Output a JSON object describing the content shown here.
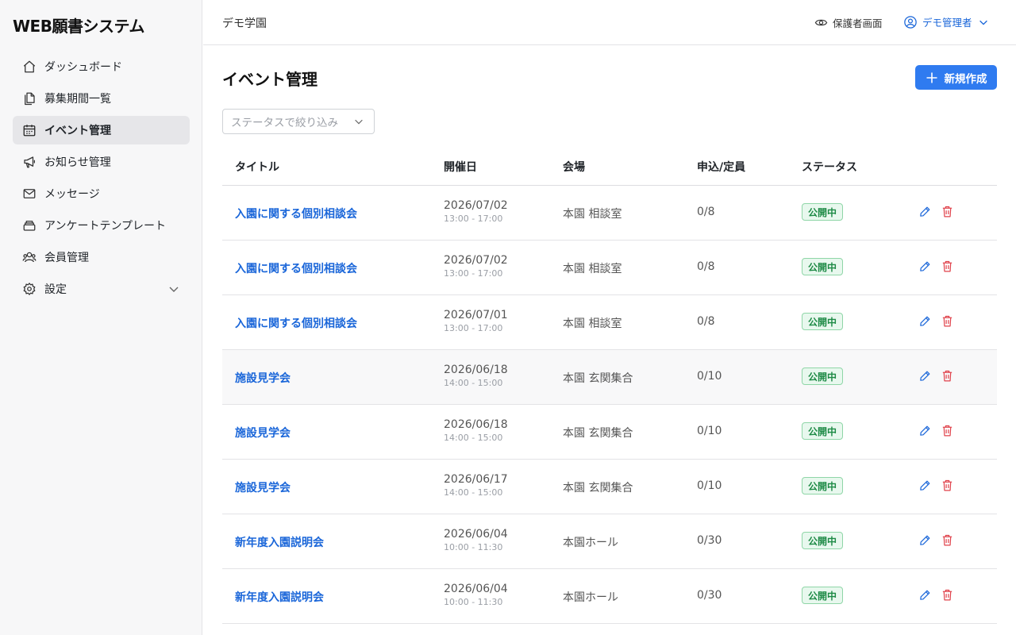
{
  "app": {
    "brand": "WEB願書システム"
  },
  "sidebar": {
    "items": [
      {
        "label": "ダッシュボード",
        "icon": "home-icon"
      },
      {
        "label": "募集期間一覧",
        "icon": "copy-icon"
      },
      {
        "label": "イベント管理",
        "icon": "calendar-icon",
        "active": true
      },
      {
        "label": "お知らせ管理",
        "icon": "megaphone-icon"
      },
      {
        "label": "メッセージ",
        "icon": "mail-icon"
      },
      {
        "label": "アンケートテンプレート",
        "icon": "stack-icon"
      },
      {
        "label": "会員管理",
        "icon": "users-icon"
      },
      {
        "label": "設定",
        "icon": "gear-icon",
        "expandable": true
      }
    ]
  },
  "header": {
    "org": "デモ学園",
    "guardian_view": "保護者画面",
    "user": "デモ管理者"
  },
  "main": {
    "title": "イベント管理",
    "new_button": "新規作成",
    "filter_placeholder": "ステータスで絞り込み",
    "columns": [
      "タイトル",
      "開催日",
      "会場",
      "申込/定員",
      "ステータス"
    ],
    "rows": [
      {
        "title": "入園に関する個別相談会",
        "date": "2026/07/02",
        "time": "13:00 - 17:00",
        "venue": "本園 相談室",
        "capacity": "0/8",
        "status": "公開中"
      },
      {
        "title": "入園に関する個別相談会",
        "date": "2026/07/02",
        "time": "13:00 - 17:00",
        "venue": "本園 相談室",
        "capacity": "0/8",
        "status": "公開中"
      },
      {
        "title": "入園に関する個別相談会",
        "date": "2026/07/01",
        "time": "13:00 - 17:00",
        "venue": "本園 相談室",
        "capacity": "0/8",
        "status": "公開中"
      },
      {
        "title": "施設見学会",
        "date": "2026/06/18",
        "time": "14:00 - 15:00",
        "venue": "本園 玄関集合",
        "capacity": "0/10",
        "status": "公開中"
      },
      {
        "title": "施設見学会",
        "date": "2026/06/18",
        "time": "14:00 - 15:00",
        "venue": "本園 玄関集合",
        "capacity": "0/10",
        "status": "公開中"
      },
      {
        "title": "施設見学会",
        "date": "2026/06/17",
        "time": "14:00 - 15:00",
        "venue": "本園 玄関集合",
        "capacity": "0/10",
        "status": "公開中"
      },
      {
        "title": "新年度入園説明会",
        "date": "2026/06/04",
        "time": "10:00 - 11:30",
        "venue": "本園ホール",
        "capacity": "0/30",
        "status": "公開中"
      },
      {
        "title": "新年度入園説明会",
        "date": "2026/06/04",
        "time": "10:00 - 11:30",
        "venue": "本園ホール",
        "capacity": "0/30",
        "status": "公開中"
      }
    ]
  },
  "colors": {
    "accent": "#2f7bf0",
    "link": "#1a66d9",
    "status_bg": "#e8f8ee",
    "status_text": "#1d8a45",
    "delete": "#e0414a"
  }
}
